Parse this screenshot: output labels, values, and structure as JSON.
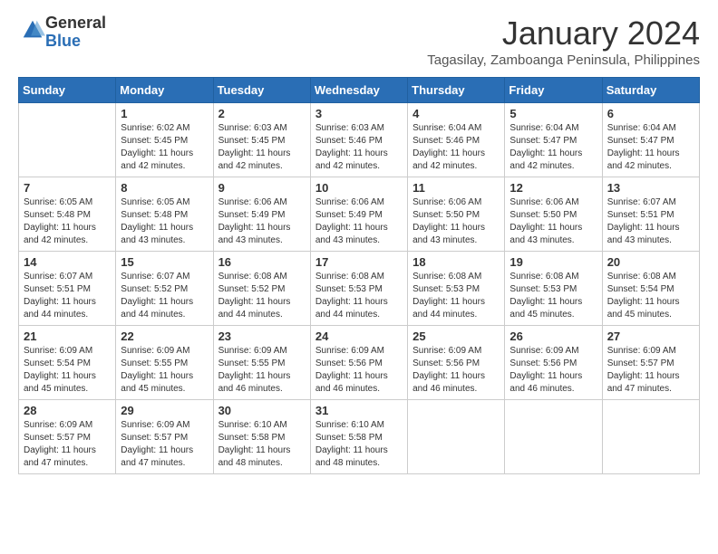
{
  "header": {
    "logo": {
      "general": "General",
      "blue": "Blue"
    },
    "month": "January 2024",
    "location": "Tagasilay, Zamboanga Peninsula, Philippines"
  },
  "weekdays": [
    "Sunday",
    "Monday",
    "Tuesday",
    "Wednesday",
    "Thursday",
    "Friday",
    "Saturday"
  ],
  "weeks": [
    [
      {
        "day": "",
        "sunrise": "",
        "sunset": "",
        "daylight": ""
      },
      {
        "day": "1",
        "sunrise": "Sunrise: 6:02 AM",
        "sunset": "Sunset: 5:45 PM",
        "daylight": "Daylight: 11 hours and 42 minutes."
      },
      {
        "day": "2",
        "sunrise": "Sunrise: 6:03 AM",
        "sunset": "Sunset: 5:45 PM",
        "daylight": "Daylight: 11 hours and 42 minutes."
      },
      {
        "day": "3",
        "sunrise": "Sunrise: 6:03 AM",
        "sunset": "Sunset: 5:46 PM",
        "daylight": "Daylight: 11 hours and 42 minutes."
      },
      {
        "day": "4",
        "sunrise": "Sunrise: 6:04 AM",
        "sunset": "Sunset: 5:46 PM",
        "daylight": "Daylight: 11 hours and 42 minutes."
      },
      {
        "day": "5",
        "sunrise": "Sunrise: 6:04 AM",
        "sunset": "Sunset: 5:47 PM",
        "daylight": "Daylight: 11 hours and 42 minutes."
      },
      {
        "day": "6",
        "sunrise": "Sunrise: 6:04 AM",
        "sunset": "Sunset: 5:47 PM",
        "daylight": "Daylight: 11 hours and 42 minutes."
      }
    ],
    [
      {
        "day": "7",
        "sunrise": "Sunrise: 6:05 AM",
        "sunset": "Sunset: 5:48 PM",
        "daylight": "Daylight: 11 hours and 42 minutes."
      },
      {
        "day": "8",
        "sunrise": "Sunrise: 6:05 AM",
        "sunset": "Sunset: 5:48 PM",
        "daylight": "Daylight: 11 hours and 43 minutes."
      },
      {
        "day": "9",
        "sunrise": "Sunrise: 6:06 AM",
        "sunset": "Sunset: 5:49 PM",
        "daylight": "Daylight: 11 hours and 43 minutes."
      },
      {
        "day": "10",
        "sunrise": "Sunrise: 6:06 AM",
        "sunset": "Sunset: 5:49 PM",
        "daylight": "Daylight: 11 hours and 43 minutes."
      },
      {
        "day": "11",
        "sunrise": "Sunrise: 6:06 AM",
        "sunset": "Sunset: 5:50 PM",
        "daylight": "Daylight: 11 hours and 43 minutes."
      },
      {
        "day": "12",
        "sunrise": "Sunrise: 6:06 AM",
        "sunset": "Sunset: 5:50 PM",
        "daylight": "Daylight: 11 hours and 43 minutes."
      },
      {
        "day": "13",
        "sunrise": "Sunrise: 6:07 AM",
        "sunset": "Sunset: 5:51 PM",
        "daylight": "Daylight: 11 hours and 43 minutes."
      }
    ],
    [
      {
        "day": "14",
        "sunrise": "Sunrise: 6:07 AM",
        "sunset": "Sunset: 5:51 PM",
        "daylight": "Daylight: 11 hours and 44 minutes."
      },
      {
        "day": "15",
        "sunrise": "Sunrise: 6:07 AM",
        "sunset": "Sunset: 5:52 PM",
        "daylight": "Daylight: 11 hours and 44 minutes."
      },
      {
        "day": "16",
        "sunrise": "Sunrise: 6:08 AM",
        "sunset": "Sunset: 5:52 PM",
        "daylight": "Daylight: 11 hours and 44 minutes."
      },
      {
        "day": "17",
        "sunrise": "Sunrise: 6:08 AM",
        "sunset": "Sunset: 5:53 PM",
        "daylight": "Daylight: 11 hours and 44 minutes."
      },
      {
        "day": "18",
        "sunrise": "Sunrise: 6:08 AM",
        "sunset": "Sunset: 5:53 PM",
        "daylight": "Daylight: 11 hours and 44 minutes."
      },
      {
        "day": "19",
        "sunrise": "Sunrise: 6:08 AM",
        "sunset": "Sunset: 5:53 PM",
        "daylight": "Daylight: 11 hours and 45 minutes."
      },
      {
        "day": "20",
        "sunrise": "Sunrise: 6:08 AM",
        "sunset": "Sunset: 5:54 PM",
        "daylight": "Daylight: 11 hours and 45 minutes."
      }
    ],
    [
      {
        "day": "21",
        "sunrise": "Sunrise: 6:09 AM",
        "sunset": "Sunset: 5:54 PM",
        "daylight": "Daylight: 11 hours and 45 minutes."
      },
      {
        "day": "22",
        "sunrise": "Sunrise: 6:09 AM",
        "sunset": "Sunset: 5:55 PM",
        "daylight": "Daylight: 11 hours and 45 minutes."
      },
      {
        "day": "23",
        "sunrise": "Sunrise: 6:09 AM",
        "sunset": "Sunset: 5:55 PM",
        "daylight": "Daylight: 11 hours and 46 minutes."
      },
      {
        "day": "24",
        "sunrise": "Sunrise: 6:09 AM",
        "sunset": "Sunset: 5:56 PM",
        "daylight": "Daylight: 11 hours and 46 minutes."
      },
      {
        "day": "25",
        "sunrise": "Sunrise: 6:09 AM",
        "sunset": "Sunset: 5:56 PM",
        "daylight": "Daylight: 11 hours and 46 minutes."
      },
      {
        "day": "26",
        "sunrise": "Sunrise: 6:09 AM",
        "sunset": "Sunset: 5:56 PM",
        "daylight": "Daylight: 11 hours and 46 minutes."
      },
      {
        "day": "27",
        "sunrise": "Sunrise: 6:09 AM",
        "sunset": "Sunset: 5:57 PM",
        "daylight": "Daylight: 11 hours and 47 minutes."
      }
    ],
    [
      {
        "day": "28",
        "sunrise": "Sunrise: 6:09 AM",
        "sunset": "Sunset: 5:57 PM",
        "daylight": "Daylight: 11 hours and 47 minutes."
      },
      {
        "day": "29",
        "sunrise": "Sunrise: 6:09 AM",
        "sunset": "Sunset: 5:57 PM",
        "daylight": "Daylight: 11 hours and 47 minutes."
      },
      {
        "day": "30",
        "sunrise": "Sunrise: 6:10 AM",
        "sunset": "Sunset: 5:58 PM",
        "daylight": "Daylight: 11 hours and 48 minutes."
      },
      {
        "day": "31",
        "sunrise": "Sunrise: 6:10 AM",
        "sunset": "Sunset: 5:58 PM",
        "daylight": "Daylight: 11 hours and 48 minutes."
      },
      {
        "day": "",
        "sunrise": "",
        "sunset": "",
        "daylight": ""
      },
      {
        "day": "",
        "sunrise": "",
        "sunset": "",
        "daylight": ""
      },
      {
        "day": "",
        "sunrise": "",
        "sunset": "",
        "daylight": ""
      }
    ]
  ]
}
